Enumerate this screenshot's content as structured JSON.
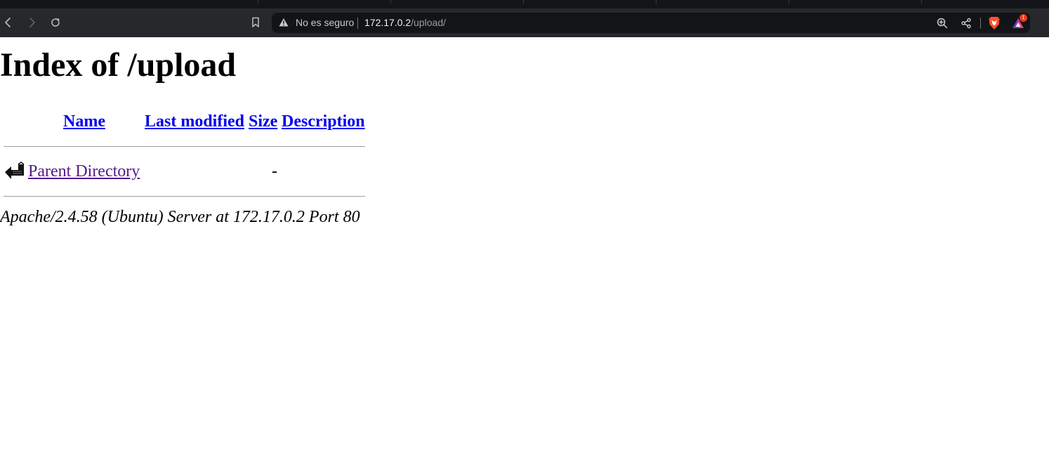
{
  "browser": {
    "omnibox": {
      "security_label": "No es seguro",
      "url_host": "172.17.0.2",
      "url_path": "/upload/"
    },
    "icons": {
      "back": "back-arrow-icon",
      "forward": "forward-arrow-icon",
      "reload": "reload-icon",
      "bookmark": "bookmark-icon",
      "warning": "warning-triangle-icon",
      "zoom": "zoom-in-icon",
      "share": "share-icon",
      "brave_shields": "brave-lion-icon",
      "brave_rewards": "brave-rewards-icon"
    },
    "rewards_badge": "1",
    "colors": {
      "chrome_bg": "#26282c",
      "omnibox_bg": "#131417",
      "brave_orange": "#fb542b"
    }
  },
  "page": {
    "title": "Index of /upload",
    "table": {
      "headers": {
        "name": "Name",
        "last_modified": "Last modified",
        "size": "Size",
        "description": "Description"
      },
      "rows": [
        {
          "icon": "back-folder-icon",
          "name": "Parent Directory",
          "last_modified": "",
          "size": "-",
          "description": ""
        }
      ]
    },
    "footer": "Apache/2.4.58 (Ubuntu) Server at 172.17.0.2 Port 80",
    "colors": {
      "link": "#0000ee",
      "visited_link": "#551a8b"
    }
  }
}
